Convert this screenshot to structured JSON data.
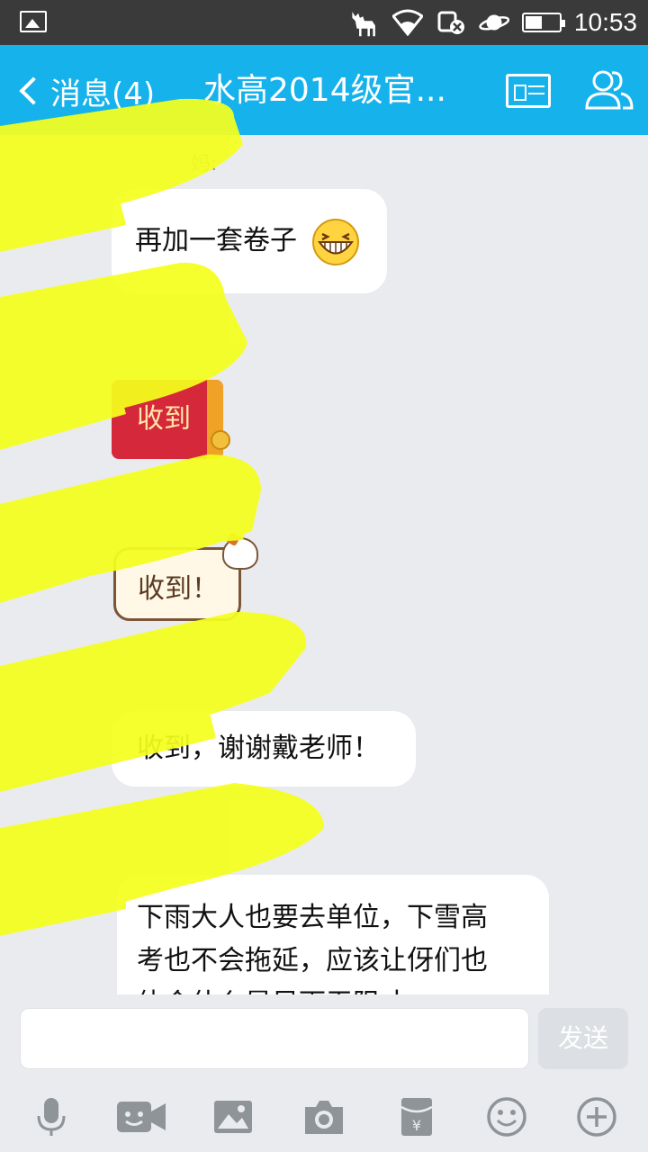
{
  "status_bar": {
    "time": "10:53",
    "icons": [
      "gallery-icon",
      "moose-icon",
      "wifi-icon",
      "data-icon",
      "planet-icon",
      "battery-icon"
    ]
  },
  "nav": {
    "back_label": "消息(4)",
    "title": "水高2014级官...",
    "icons": [
      "profile-card-icon",
      "group-members-icon"
    ],
    "color": "#16b2ec"
  },
  "chat": {
    "messages": [
      {
        "sender": "妈:",
        "text": "再加一套卷子",
        "emoji": "grin-emoji"
      },
      {
        "sender": "",
        "text": "收到",
        "type": "red-packet"
      },
      {
        "sender": "",
        "text": "收到！",
        "type": "cat-sticker"
      },
      {
        "sender": "",
        "text": "收到，谢谢戴老师！"
      },
      {
        "sender": "",
        "text_lines": [
          "下雨大人也要去单位，下雪高",
          "考也不会拖延，应该让伢们也",
          "体会什么是风雨无阻才"
        ]
      }
    ]
  },
  "input": {
    "placeholder": "",
    "send_label": "发送"
  },
  "toolbar": {
    "icons": [
      "microphone-icon",
      "video-call-icon",
      "image-icon",
      "camera-icon",
      "red-packet-icon",
      "emoji-icon",
      "plus-icon"
    ]
  },
  "colors": {
    "background": "#e9ebee",
    "highlight": "#f5ff1e",
    "red_packet": "#d5283a"
  }
}
